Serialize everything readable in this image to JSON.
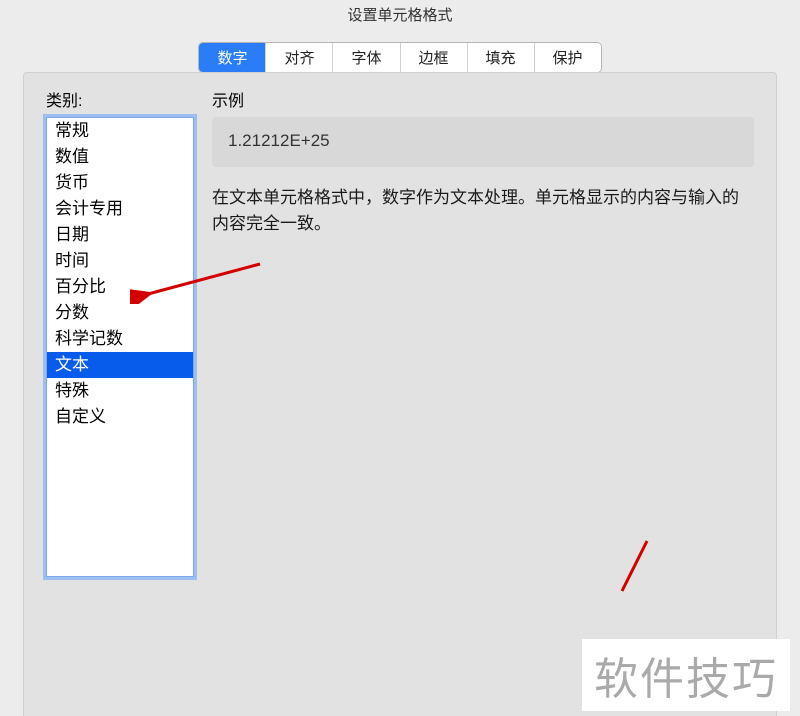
{
  "title": "设置单元格格式",
  "tabs": {
    "items": [
      "数字",
      "对齐",
      "字体",
      "边框",
      "填充",
      "保护"
    ],
    "activeIndex": 0
  },
  "leftLabel": "类别:",
  "rightLabel": "示例",
  "categories": {
    "items": [
      "常规",
      "数值",
      "货币",
      "会计专用",
      "日期",
      "时间",
      "百分比",
      "分数",
      "科学记数",
      "文本",
      "特殊",
      "自定义"
    ],
    "selectedIndex": 9
  },
  "exampleValue": "1.21212E+25",
  "description": "在文本单元格格式中，数字作为文本处理。单元格显示的内容与输入的内容完全一致。",
  "watermark": "软件技巧"
}
